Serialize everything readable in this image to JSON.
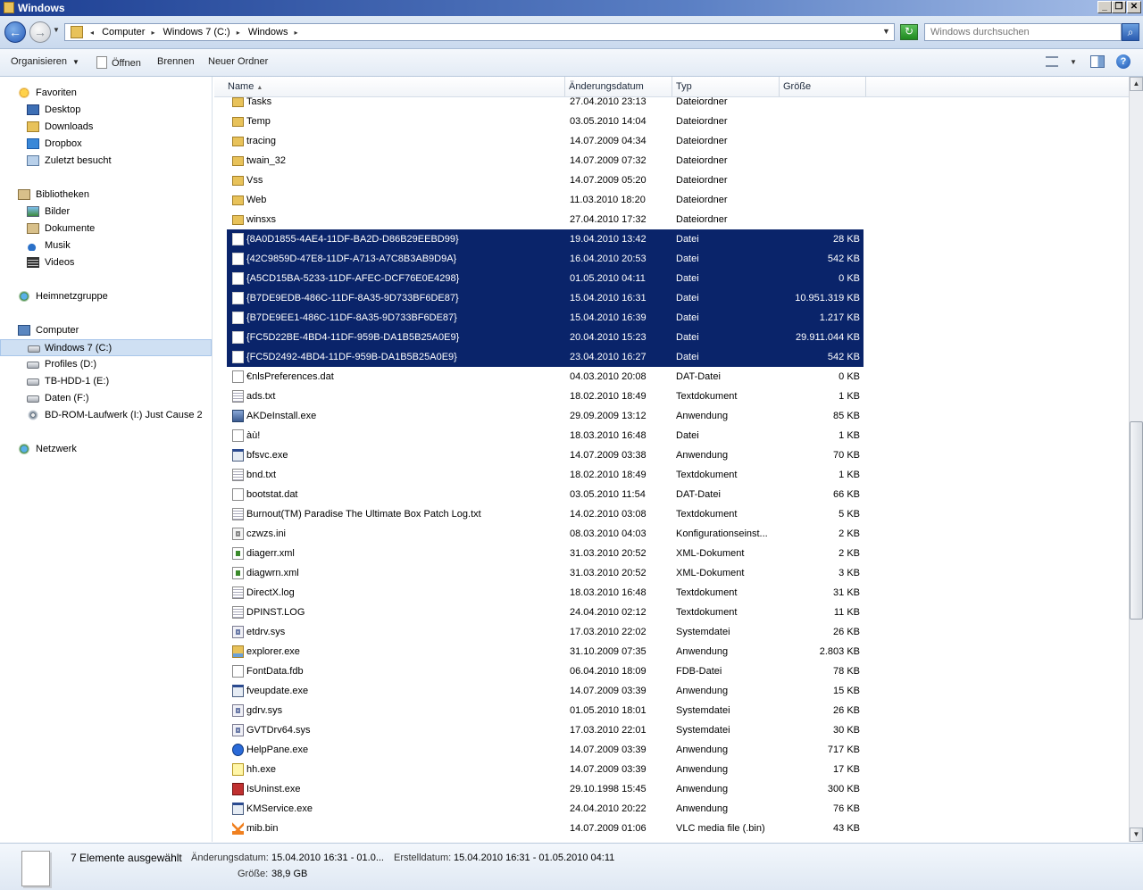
{
  "window": {
    "title": "Windows"
  },
  "address": {
    "breadcrumbs": [
      "Computer",
      "Windows 7 (C:)",
      "Windows"
    ],
    "search_placeholder": "Windows durchsuchen"
  },
  "toolbar": {
    "organize": "Organisieren",
    "open": "Öffnen",
    "burn": "Brennen",
    "new_folder": "Neuer Ordner"
  },
  "nav": {
    "favorites": "Favoriten",
    "fav_items": [
      "Desktop",
      "Downloads",
      "Dropbox",
      "Zuletzt besucht"
    ],
    "libraries": "Bibliotheken",
    "lib_items": [
      "Bilder",
      "Dokumente",
      "Musik",
      "Videos"
    ],
    "homegroup": "Heimnetzgruppe",
    "computer": "Computer",
    "drives": [
      "Windows 7 (C:)",
      "Profiles (D:)",
      "TB-HDD-1 (E:)",
      "Daten (F:)",
      "BD-ROM-Laufwerk (I:) Just Cause 2"
    ],
    "network": "Netzwerk"
  },
  "columns": {
    "name": "Name",
    "date": "Änderungsdatum",
    "type": "Typ",
    "size": "Größe"
  },
  "files": [
    {
      "name": "Tasks",
      "date": "27.04.2010 23:13",
      "type": "Dateiordner",
      "size": "",
      "icon": "folder",
      "selected": false
    },
    {
      "name": "Temp",
      "date": "03.05.2010 14:04",
      "type": "Dateiordner",
      "size": "",
      "icon": "folder",
      "selected": false
    },
    {
      "name": "tracing",
      "date": "14.07.2009 04:34",
      "type": "Dateiordner",
      "size": "",
      "icon": "folder",
      "selected": false
    },
    {
      "name": "twain_32",
      "date": "14.07.2009 07:32",
      "type": "Dateiordner",
      "size": "",
      "icon": "folder",
      "selected": false
    },
    {
      "name": "Vss",
      "date": "14.07.2009 05:20",
      "type": "Dateiordner",
      "size": "",
      "icon": "folder",
      "selected": false
    },
    {
      "name": "Web",
      "date": "11.03.2010 18:20",
      "type": "Dateiordner",
      "size": "",
      "icon": "folder",
      "selected": false
    },
    {
      "name": "winsxs",
      "date": "27.04.2010 17:32",
      "type": "Dateiordner",
      "size": "",
      "icon": "folder",
      "selected": false
    },
    {
      "name": "{8A0D1855-4AE4-11DF-BA2D-D86B29EEBD99}",
      "date": "19.04.2010 13:42",
      "type": "Datei",
      "size": "28 KB",
      "icon": "file",
      "selected": true
    },
    {
      "name": "{42C9859D-47E8-11DF-A713-A7C8B3AB9D9A}",
      "date": "16.04.2010 20:53",
      "type": "Datei",
      "size": "542 KB",
      "icon": "file",
      "selected": true
    },
    {
      "name": "{A5CD15BA-5233-11DF-AFEC-DCF76E0E4298}",
      "date": "01.05.2010 04:11",
      "type": "Datei",
      "size": "0 KB",
      "icon": "file",
      "selected": true
    },
    {
      "name": "{B7DE9EDB-486C-11DF-8A35-9D733BF6DE87}",
      "date": "15.04.2010 16:31",
      "type": "Datei",
      "size": "10.951.319 KB",
      "icon": "file",
      "selected": true
    },
    {
      "name": "{B7DE9EE1-486C-11DF-8A35-9D733BF6DE87}",
      "date": "15.04.2010 16:39",
      "type": "Datei",
      "size": "1.217 KB",
      "icon": "file",
      "selected": true
    },
    {
      "name": "{FC5D22BE-4BD4-11DF-959B-DA1B5B25A0E9}",
      "date": "20.04.2010 15:23",
      "type": "Datei",
      "size": "29.911.044 KB",
      "icon": "file",
      "selected": true
    },
    {
      "name": "{FC5D2492-4BD4-11DF-959B-DA1B5B25A0E9}",
      "date": "23.04.2010 16:27",
      "type": "Datei",
      "size": "542 KB",
      "icon": "file",
      "selected": true
    },
    {
      "name": "€nlsPreferences.dat",
      "date": "04.03.2010 20:08",
      "type": "DAT-Datei",
      "size": "0 KB",
      "icon": "file",
      "selected": false
    },
    {
      "name": "ads.txt",
      "date": "18.02.2010 18:49",
      "type": "Textdokument",
      "size": "1 KB",
      "icon": "txt",
      "selected": false
    },
    {
      "name": "AKDeInstall.exe",
      "date": "29.09.2009 13:12",
      "type": "Anwendung",
      "size": "85 KB",
      "icon": "ak",
      "selected": false
    },
    {
      "name": "àù!",
      "date": "18.03.2010 16:48",
      "type": "Datei",
      "size": "1 KB",
      "icon": "file",
      "selected": false
    },
    {
      "name": "bfsvc.exe",
      "date": "14.07.2009 03:38",
      "type": "Anwendung",
      "size": "70 KB",
      "icon": "exe",
      "selected": false
    },
    {
      "name": "bnd.txt",
      "date": "18.02.2010 18:49",
      "type": "Textdokument",
      "size": "1 KB",
      "icon": "txt",
      "selected": false
    },
    {
      "name": "bootstat.dat",
      "date": "03.05.2010 11:54",
      "type": "DAT-Datei",
      "size": "66 KB",
      "icon": "file",
      "selected": false
    },
    {
      "name": "Burnout(TM) Paradise The Ultimate Box Patch Log.txt",
      "date": "14.02.2010 03:08",
      "type": "Textdokument",
      "size": "5 KB",
      "icon": "txt",
      "selected": false
    },
    {
      "name": "czwzs.ini",
      "date": "08.03.2010 04:03",
      "type": "Konfigurationseinst...",
      "size": "2 KB",
      "icon": "ini",
      "selected": false
    },
    {
      "name": "diagerr.xml",
      "date": "31.03.2010 20:52",
      "type": "XML-Dokument",
      "size": "2 KB",
      "icon": "xml",
      "selected": false
    },
    {
      "name": "diagwrn.xml",
      "date": "31.03.2010 20:52",
      "type": "XML-Dokument",
      "size": "3 KB",
      "icon": "xml",
      "selected": false
    },
    {
      "name": "DirectX.log",
      "date": "18.03.2010 16:48",
      "type": "Textdokument",
      "size": "31 KB",
      "icon": "txt",
      "selected": false
    },
    {
      "name": "DPINST.LOG",
      "date": "24.04.2010 02:12",
      "type": "Textdokument",
      "size": "11 KB",
      "icon": "txt",
      "selected": false
    },
    {
      "name": "etdrv.sys",
      "date": "17.03.2010 22:02",
      "type": "Systemdatei",
      "size": "26 KB",
      "icon": "sys",
      "selected": false
    },
    {
      "name": "explorer.exe",
      "date": "31.10.2009 07:35",
      "type": "Anwendung",
      "size": "2.803 KB",
      "icon": "explorer",
      "selected": false
    },
    {
      "name": "FontData.fdb",
      "date": "06.04.2010 18:09",
      "type": "FDB-Datei",
      "size": "78 KB",
      "icon": "file",
      "selected": false
    },
    {
      "name": "fveupdate.exe",
      "date": "14.07.2009 03:39",
      "type": "Anwendung",
      "size": "15 KB",
      "icon": "exe",
      "selected": false
    },
    {
      "name": "gdrv.sys",
      "date": "01.05.2010 18:01",
      "type": "Systemdatei",
      "size": "26 KB",
      "icon": "sys",
      "selected": false
    },
    {
      "name": "GVTDrv64.sys",
      "date": "17.03.2010 22:01",
      "type": "Systemdatei",
      "size": "30 KB",
      "icon": "sys",
      "selected": false
    },
    {
      "name": "HelpPane.exe",
      "date": "14.07.2009 03:39",
      "type": "Anwendung",
      "size": "717 KB",
      "icon": "hp",
      "selected": false
    },
    {
      "name": "hh.exe",
      "date": "14.07.2009 03:39",
      "type": "Anwendung",
      "size": "17 KB",
      "icon": "hh",
      "selected": false
    },
    {
      "name": "IsUninst.exe",
      "date": "29.10.1998 15:45",
      "type": "Anwendung",
      "size": "300 KB",
      "icon": "box",
      "selected": false
    },
    {
      "name": "KMService.exe",
      "date": "24.04.2010 20:22",
      "type": "Anwendung",
      "size": "76 KB",
      "icon": "exe",
      "selected": false
    },
    {
      "name": "mib.bin",
      "date": "14.07.2009 01:06",
      "type": "VLC media file (.bin)",
      "size": "43 KB",
      "icon": "vlc",
      "selected": false
    }
  ],
  "details": {
    "count": "7 Elemente ausgewählt",
    "modified_label": "Änderungsdatum:",
    "modified_value": "15.04.2010 16:31 - 01.0...",
    "created_label": "Erstelldatum:",
    "created_value": "15.04.2010 16:31 - 01.05.2010 04:11",
    "size_label": "Größe:",
    "size_value": "38,9 GB"
  },
  "colors": {
    "selection": "#0a246a",
    "title_bar": "#1d3f93"
  }
}
